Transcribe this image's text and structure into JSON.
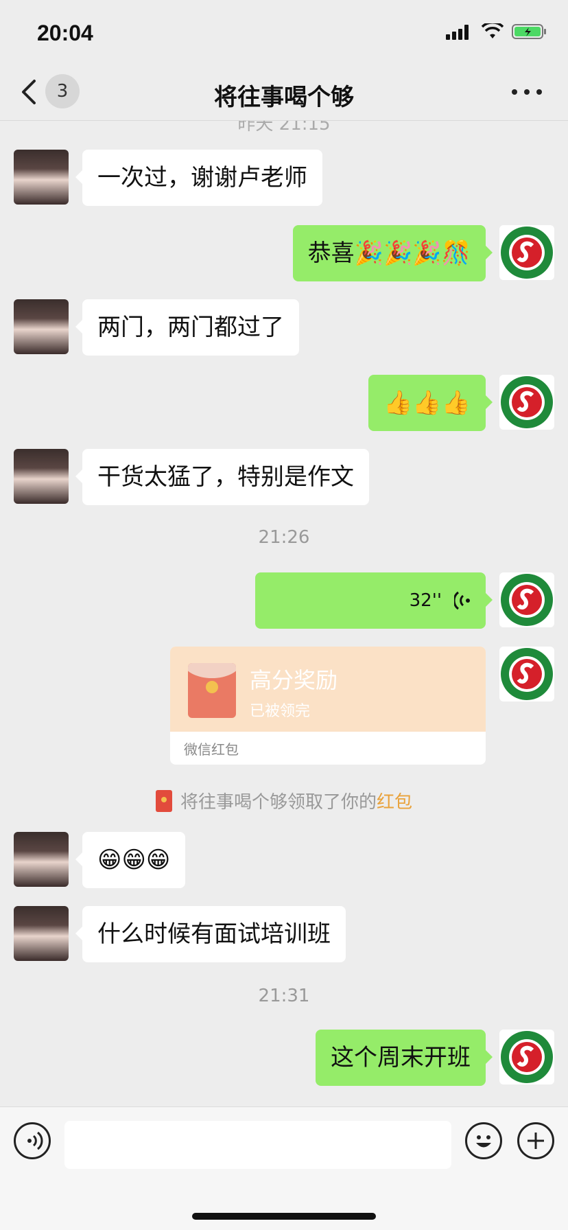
{
  "status_bar": {
    "time": "20:04"
  },
  "nav": {
    "unread_count": "3",
    "title": "将往事喝个够"
  },
  "chat": {
    "cut_timestamp": "昨天 21:15",
    "messages": [
      {
        "text": "一次过，谢谢卢老师"
      },
      {
        "text": "恭喜🎉🎉🎉🎊"
      },
      {
        "text": "两门，两门都过了"
      },
      {
        "text": "👍👍👍"
      },
      {
        "text": "干货太猛了，特别是作文"
      },
      {
        "text": "😁😁😁"
      },
      {
        "text": "什么时候有面试培训班"
      },
      {
        "text": "这个周末开班"
      }
    ],
    "time_separators": [
      "21:26",
      "21:31"
    ],
    "voice": {
      "duration": "32''"
    },
    "red_packet": {
      "title": "高分奖励",
      "status": "已被领完",
      "footer": "微信红包"
    },
    "system": {
      "prefix": "将往事喝个够领取了你的",
      "link": "红包"
    }
  },
  "colors": {
    "sent_bubble": "#95ec69",
    "received_bubble": "#ffffff",
    "background": "#ededed",
    "red_packet": "#fbe1c6"
  }
}
